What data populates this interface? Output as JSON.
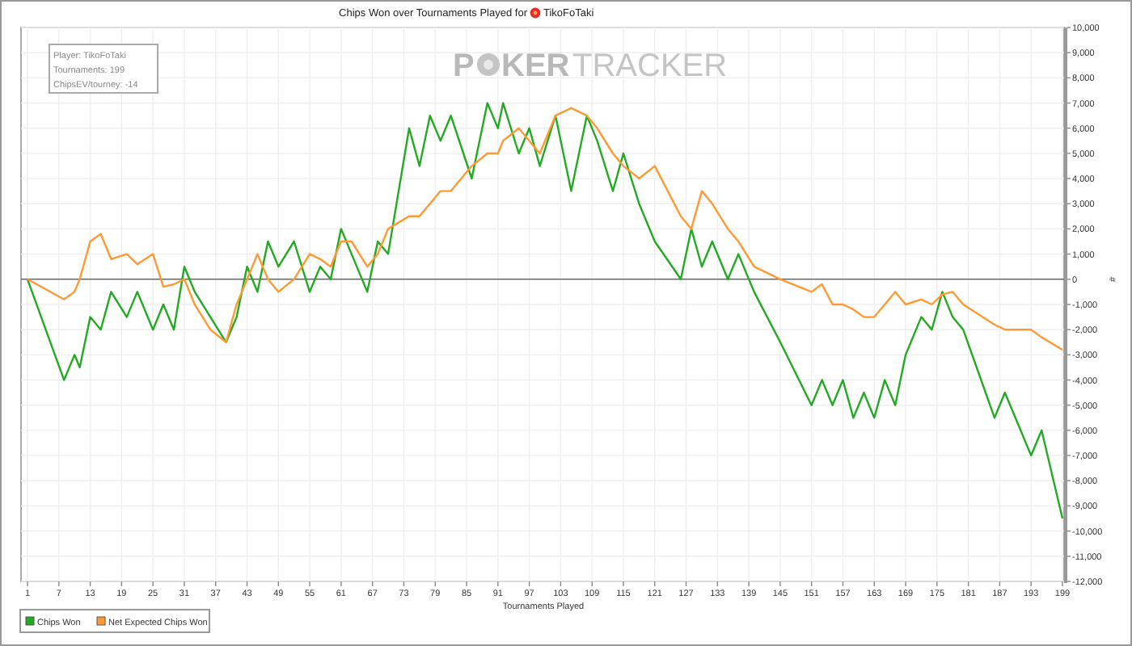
{
  "chart": {
    "title": "Chips Won over Tournaments Played for",
    "title_player": "TikoFoTaki",
    "info_box": [
      "Player: TikoFoTaki",
      "Tournaments: 199",
      "ChipsEV/tourney: -14"
    ],
    "watermark": {
      "bold_start": "P",
      "bold_end": "KER",
      "light": "TRACKER"
    },
    "chart_data": {
      "type": "line",
      "xlabel": "Tournaments Played",
      "ylabel": "#",
      "x": [
        1,
        8,
        10,
        11,
        13,
        15,
        17,
        20,
        22,
        25,
        27,
        29,
        31,
        33,
        36,
        39,
        41,
        43,
        45,
        47,
        49,
        52,
        55,
        57,
        59,
        61,
        63,
        66,
        68,
        70,
        74,
        76,
        78,
        80,
        82,
        86,
        89,
        91,
        92,
        95,
        97,
        99,
        102,
        105,
        108,
        110,
        113,
        115,
        118,
        121,
        126,
        128,
        130,
        132,
        135,
        137,
        140,
        145,
        151,
        153,
        155,
        157,
        159,
        161,
        163,
        165,
        167,
        169,
        172,
        174,
        176,
        178,
        180,
        186,
        188,
        193,
        195,
        199
      ],
      "series": [
        {
          "name": "Chips Won",
          "color": "#22aa22",
          "values": [
            0,
            -4000,
            -3000,
            -3500,
            -1500,
            -2000,
            -500,
            -1500,
            -500,
            -2000,
            -1000,
            -2000,
            500,
            -500,
            -1500,
            -2500,
            -1500,
            500,
            -500,
            1500,
            500,
            1500,
            -500,
            500,
            0,
            2000,
            1000,
            -500,
            1500,
            1000,
            6000,
            4500,
            6500,
            5500,
            6500,
            4000,
            7000,
            6000,
            7000,
            5000,
            6000,
            4500,
            6500,
            3500,
            6500,
            5500,
            3500,
            5000,
            3000,
            1500,
            0,
            2000,
            500,
            1500,
            0,
            1000,
            -500,
            -2500,
            -5000,
            -4000,
            -5000,
            -4000,
            -5500,
            -4500,
            -5500,
            -4000,
            -5000,
            -3000,
            -1500,
            -2000,
            -500,
            -1500,
            -2000,
            -5500,
            -4500,
            -7000,
            -6000,
            -9500
          ]
        },
        {
          "name": "Net Expected Chips Won",
          "color": "#ff9933",
          "values": [
            0,
            -800,
            -500,
            0,
            1500,
            1800,
            800,
            1000,
            600,
            1000,
            -300,
            -200,
            0,
            -1000,
            -2000,
            -2500,
            -1000,
            0,
            1000,
            0,
            -500,
            0,
            1000,
            800,
            500,
            1500,
            1500,
            500,
            1000,
            2000,
            2500,
            2500,
            3000,
            3500,
            3500,
            4500,
            5000,
            5000,
            5500,
            6000,
            5500,
            5000,
            6500,
            6800,
            6500,
            6000,
            5000,
            4500,
            4000,
            4500,
            2500,
            2000,
            3500,
            3000,
            2000,
            1500,
            500,
            0,
            -500,
            -200,
            -1000,
            -1000,
            -1200,
            -1500,
            -1500,
            -1000,
            -500,
            -1000,
            -800,
            -1000,
            -600,
            -500,
            -1000,
            -1800,
            -2000,
            -2000,
            -2300,
            -2800
          ]
        }
      ],
      "grid": true,
      "legend": true,
      "xlim": [
        1,
        199
      ],
      "ylim": [
        -12000,
        10000
      ],
      "xticks": [
        1,
        7,
        13,
        19,
        25,
        31,
        37,
        43,
        49,
        55,
        61,
        67,
        73,
        79,
        85,
        91,
        97,
        103,
        109,
        115,
        121,
        127,
        133,
        139,
        145,
        151,
        157,
        163,
        169,
        175,
        181,
        187,
        193,
        199
      ],
      "yticks": [
        {
          "value": 10000,
          "label": "10,000"
        },
        {
          "value": 9000,
          "label": "9,000"
        },
        {
          "value": 8000,
          "label": "8,000"
        },
        {
          "value": 7000,
          "label": "7,000"
        },
        {
          "value": 6000,
          "label": "6,000"
        },
        {
          "value": 5000,
          "label": "5,000"
        },
        {
          "value": 4000,
          "label": "4,000"
        },
        {
          "value": 3000,
          "label": "3,000"
        },
        {
          "value": 2000,
          "label": "2,000"
        },
        {
          "value": 1000,
          "label": "1,000"
        },
        {
          "value": 0,
          "label": "0"
        },
        {
          "value": -1000,
          "label": "-1,000"
        },
        {
          "value": -2000,
          "label": "-2,000"
        },
        {
          "value": -3000,
          "label": "-3,000"
        },
        {
          "value": -4000,
          "label": "-4,000"
        },
        {
          "value": -5000,
          "label": "-5,000"
        },
        {
          "value": -6000,
          "label": "-6,000"
        },
        {
          "value": -7000,
          "label": "-7,000"
        },
        {
          "value": -8000,
          "label": "-8,000"
        },
        {
          "value": -9000,
          "label": "-9,000"
        },
        {
          "value": -10000,
          "label": "-10,000"
        },
        {
          "value": -11000,
          "label": "-11,000"
        },
        {
          "value": -12000,
          "label": "-12,000"
        }
      ]
    }
  }
}
